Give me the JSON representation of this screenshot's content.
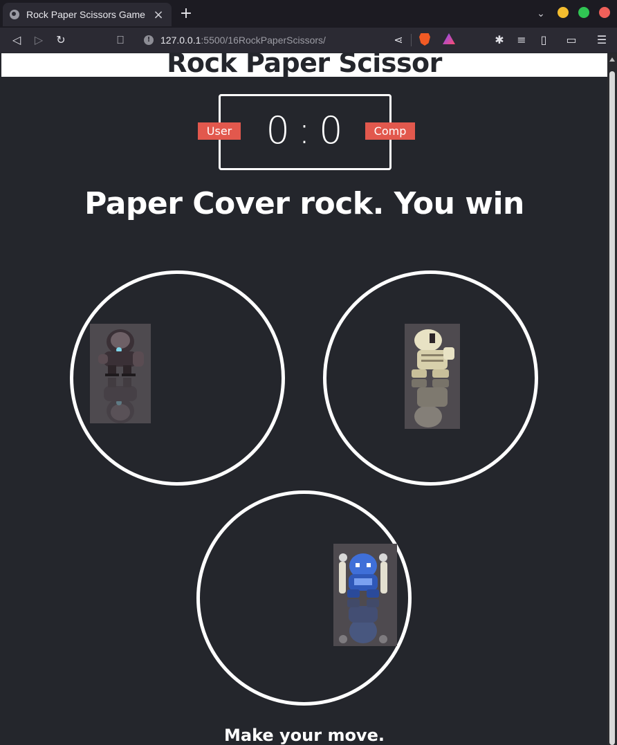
{
  "browser": {
    "tab_title": "Rock Paper Scissors Game",
    "url_host": "127.0.0.1",
    "url_path": ":5500/16RockPaperScissors/"
  },
  "page": {
    "title": "Rock Paper Scissor",
    "user_label": "User",
    "comp_label": "Comp",
    "user_score": "0",
    "score_separator": ":",
    "comp_score": "0",
    "result_message": "Paper Cover rock. You win",
    "move_prompt": "Make your move."
  },
  "colors": {
    "background": "#24262c",
    "accent": "#e2584d",
    "text": "#ffffff"
  },
  "choices": [
    "rock-sprite",
    "paper-sprite",
    "scissors-sprite"
  ]
}
